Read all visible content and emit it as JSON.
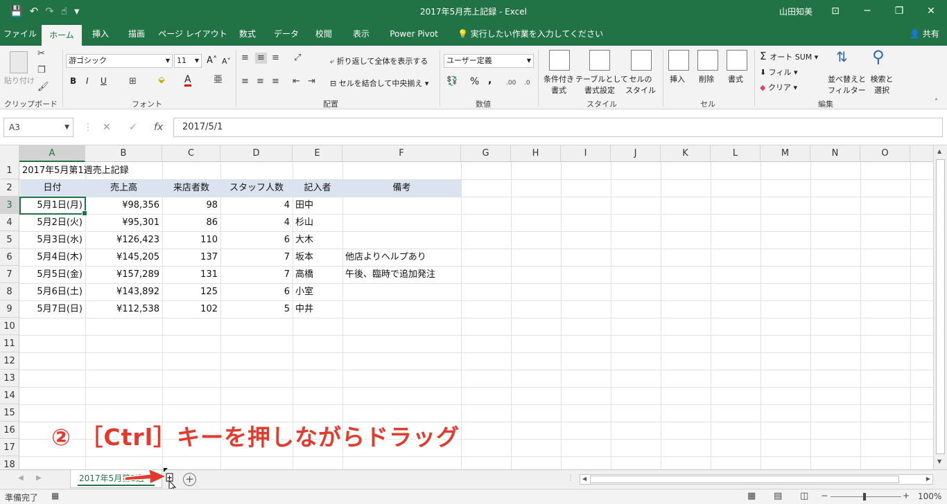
{
  "window": {
    "title": "2017年5月売上記録  -  Excel",
    "user": "山田知美",
    "minimize_icon": "─",
    "restore_icon": "❐",
    "close_icon": "✕",
    "ribbon_display_icon": "⊡"
  },
  "qat": {
    "save_icon": "💾",
    "undo_icon": "↶",
    "redo_icon": "↷",
    "touch_icon": "☝",
    "customize_icon": "▾"
  },
  "tabs": [
    {
      "label": "ファイル"
    },
    {
      "label": "ホーム"
    },
    {
      "label": "挿入"
    },
    {
      "label": "描画"
    },
    {
      "label": "ページ レイアウト"
    },
    {
      "label": "数式"
    },
    {
      "label": "データ"
    },
    {
      "label": "校閲"
    },
    {
      "label": "表示"
    },
    {
      "label": "Power Pivot"
    }
  ],
  "tell_me": "実行したい作業を入力してください",
  "share": "共有",
  "ribbon": {
    "clipboard": {
      "label": "クリップボード",
      "paste": "貼り付け"
    },
    "font": {
      "label": "フォント",
      "name": "游ゴシック",
      "size": "11",
      "bold": "B",
      "italic": "I",
      "underline": "U"
    },
    "alignment": {
      "label": "配置",
      "wrap": "折り返して全体を表示する",
      "merge": "セルを結合して中央揃え"
    },
    "number": {
      "label": "数値",
      "format": "ユーザー定義",
      "percent": "%",
      "comma": ","
    },
    "styles": {
      "label": "スタイル",
      "conditional_1": "条件付き",
      "conditional_2": "書式",
      "table_1": "テーブルとして",
      "table_2": "書式設定",
      "cell_1": "セルの",
      "cell_2": "スタイル"
    },
    "cells": {
      "label": "セル",
      "insert": "挿入",
      "delete": "削除",
      "format": "書式"
    },
    "editing": {
      "label": "編集",
      "autosum": "オート SUM",
      "fill": "フィル",
      "clear": "クリア",
      "sort_1": "並べ替えと",
      "sort_2": "フィルター",
      "find_1": "検索と",
      "find_2": "選択"
    }
  },
  "formula_bar": {
    "name_box": "A3",
    "fx": "fx",
    "cancel_icon": "✕",
    "enter_icon": "✓",
    "content": "2017/5/1"
  },
  "columns": [
    "A",
    "B",
    "C",
    "D",
    "E",
    "F",
    "G",
    "H",
    "I",
    "J",
    "K",
    "L",
    "M",
    "N",
    "O"
  ],
  "rows": [
    "1",
    "2",
    "3",
    "4",
    "5",
    "6",
    "7",
    "8",
    "9",
    "10",
    "11",
    "12",
    "13",
    "14",
    "15",
    "16",
    "17",
    "18"
  ],
  "sheet": {
    "title": "2017年5月第1週売上記録",
    "headers": [
      "日付",
      "売上高",
      "来店者数",
      "スタッフ人数",
      "記入者",
      "備考"
    ],
    "data": [
      [
        "5月1日(月)",
        "¥98,356",
        "98",
        "4",
        "田中",
        ""
      ],
      [
        "5月2日(火)",
        "¥95,301",
        "86",
        "4",
        "杉山",
        ""
      ],
      [
        "5月3日(水)",
        "¥126,423",
        "110",
        "6",
        "大木",
        ""
      ],
      [
        "5月4日(木)",
        "¥145,205",
        "137",
        "7",
        "坂本",
        "他店よりヘルプあり"
      ],
      [
        "5月5日(金)",
        "¥157,289",
        "131",
        "7",
        "高橋",
        "午後、臨時で追加発注"
      ],
      [
        "5月6日(土)",
        "¥143,892",
        "125",
        "6",
        "小室",
        ""
      ],
      [
        "5月7日(日)",
        "¥112,538",
        "102",
        "5",
        "中井",
        ""
      ]
    ]
  },
  "annotation": "② ［Ctrl］キーを押しながらドラッグ",
  "sheet_tabs": [
    {
      "label": "2017年5月第1週"
    }
  ],
  "add_sheet_icon": "+",
  "status": {
    "ready": "準備完了",
    "zoom": "100%",
    "zoom_minus": "−",
    "zoom_plus": "+"
  }
}
